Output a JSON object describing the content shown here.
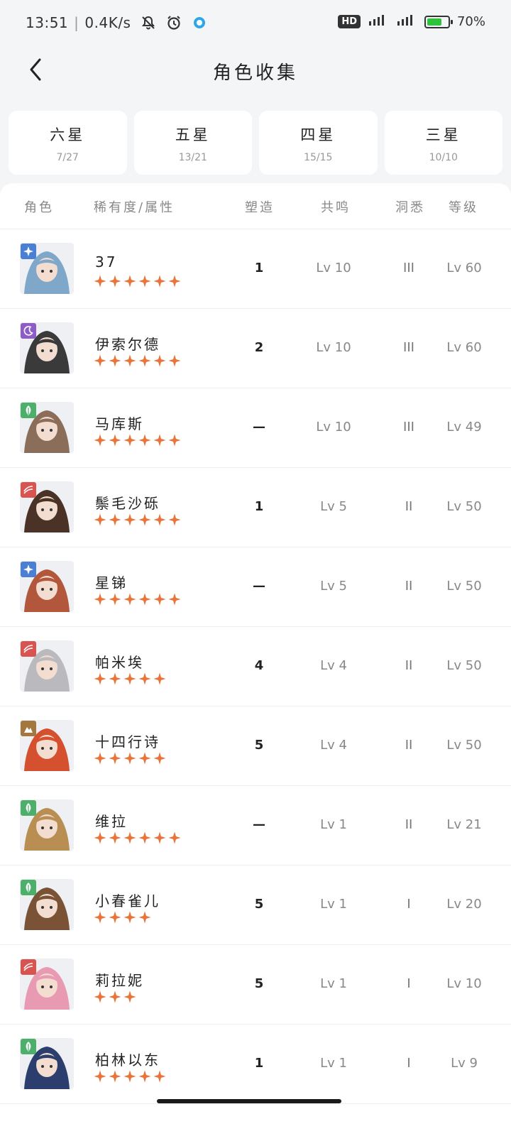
{
  "status_bar": {
    "time": "13:51",
    "network_speed": "0.4K/s",
    "hd_label": "HD",
    "signal_1_label": "4G",
    "signal_2_label": "5G",
    "battery_percent": "70%",
    "battery_level": 0.7,
    "icons": [
      "bell-muted-icon",
      "alarm-icon",
      "app-status-icon",
      "signal-icon",
      "battery-icon"
    ]
  },
  "header": {
    "title": "角色收集",
    "back_icon": "chevron-left-icon"
  },
  "tabs": [
    {
      "label": "六星",
      "count": "7/27"
    },
    {
      "label": "五星",
      "count": "13/21"
    },
    {
      "label": "四星",
      "count": "15/15"
    },
    {
      "label": "三星",
      "count": "10/10"
    }
  ],
  "columns": {
    "character": "角色",
    "rarity_attribute": "稀有度/属性",
    "shape": "塑造",
    "resonance": "共鸣",
    "insight": "洞悉",
    "level": "等级"
  },
  "colors": {
    "star": "#e8743b",
    "attr_blue": "#4a7fd6",
    "attr_purple": "#8e5cc8",
    "attr_green": "#4caf6a",
    "attr_red": "#d9534f",
    "attr_brown": "#a3773e",
    "battery": "#2fc23d"
  },
  "characters": [
    {
      "name": "37",
      "stars": 6,
      "attribute_icon": "star-attribute-icon",
      "attribute_color": "#4a7fd6",
      "portrait_color": "#7fa7c9",
      "shape": "1",
      "resonance": "Lv 10",
      "insight": "III",
      "level": "Lv 60"
    },
    {
      "name": "伊索尔德",
      "stars": 6,
      "attribute_icon": "moon-attribute-icon",
      "attribute_color": "#8e5cc8",
      "portrait_color": "#3a3a3a",
      "shape": "2",
      "resonance": "Lv 10",
      "insight": "III",
      "level": "Lv 60"
    },
    {
      "name": "马库斯",
      "stars": 6,
      "attribute_icon": "leaf-attribute-icon",
      "attribute_color": "#4caf6a",
      "portrait_color": "#8b6e5a",
      "shape": "—",
      "resonance": "Lv 10",
      "insight": "III",
      "level": "Lv 49"
    },
    {
      "name": "鬃毛沙砾",
      "stars": 6,
      "attribute_icon": "claw-attribute-icon",
      "attribute_color": "#d9534f",
      "portrait_color": "#4a3226",
      "shape": "1",
      "resonance": "Lv 5",
      "insight": "II",
      "level": "Lv 50"
    },
    {
      "name": "星锑",
      "stars": 6,
      "attribute_icon": "star-attribute-icon",
      "attribute_color": "#4a7fd6",
      "portrait_color": "#b2573c",
      "shape": "—",
      "resonance": "Lv 5",
      "insight": "II",
      "level": "Lv 50"
    },
    {
      "name": "帕米埃",
      "stars": 5,
      "attribute_icon": "claw-attribute-icon",
      "attribute_color": "#d9534f",
      "portrait_color": "#b9b9be",
      "shape": "4",
      "resonance": "Lv 4",
      "insight": "II",
      "level": "Lv 50"
    },
    {
      "name": "十四行诗",
      "stars": 5,
      "attribute_icon": "rock-attribute-icon",
      "attribute_color": "#a3773e",
      "portrait_color": "#d4502e",
      "shape": "5",
      "resonance": "Lv 4",
      "insight": "II",
      "level": "Lv 50"
    },
    {
      "name": "维拉",
      "stars": 6,
      "attribute_icon": "leaf-attribute-icon",
      "attribute_color": "#4caf6a",
      "portrait_color": "#b98e52",
      "shape": "—",
      "resonance": "Lv 1",
      "insight": "II",
      "level": "Lv 21"
    },
    {
      "name": "小春雀儿",
      "stars": 4,
      "attribute_icon": "leaf-attribute-icon",
      "attribute_color": "#4caf6a",
      "portrait_color": "#7a5236",
      "shape": "5",
      "resonance": "Lv 1",
      "insight": "I",
      "level": "Lv 20"
    },
    {
      "name": "莉拉妮",
      "stars": 3,
      "attribute_icon": "claw-attribute-icon",
      "attribute_color": "#d9534f",
      "portrait_color": "#e89ab2",
      "shape": "5",
      "resonance": "Lv 1",
      "insight": "I",
      "level": "Lv 10"
    },
    {
      "name": "柏林以东",
      "stars": 5,
      "attribute_icon": "leaf-attribute-icon",
      "attribute_color": "#4caf6a",
      "portrait_color": "#2b3e6e",
      "shape": "1",
      "resonance": "Lv 1",
      "insight": "I",
      "level": "Lv 9"
    }
  ]
}
